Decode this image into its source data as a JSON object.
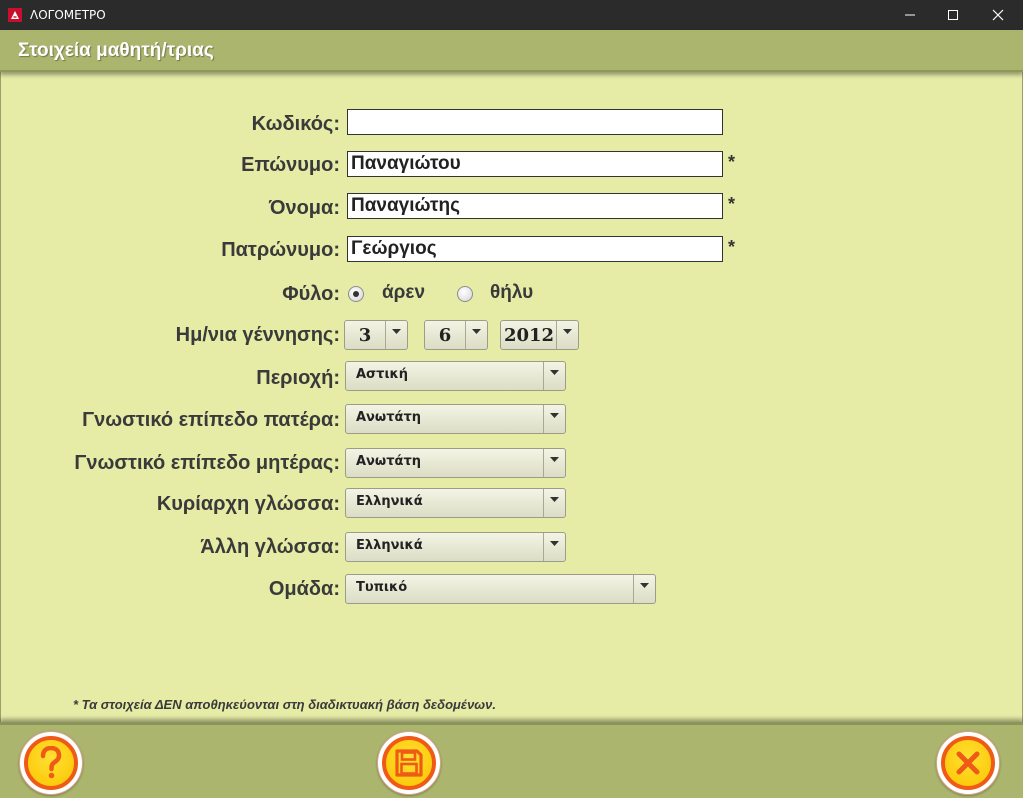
{
  "window": {
    "title": "ΛΟΓΟΜΕΤΡΟ"
  },
  "header": {
    "title": "Στοιχεία μαθητή/τριας"
  },
  "form": {
    "code": {
      "label": "Κωδικός:",
      "value": ""
    },
    "surname": {
      "label": "Επώνυμο:",
      "value": "Παναγιώτου",
      "required_mark": "*"
    },
    "name": {
      "label": "Όνομα:",
      "value": "Παναγιώτης",
      "required_mark": "*"
    },
    "father_name": {
      "label": "Πατρώνυμο:",
      "value": "Γεώργιος",
      "required_mark": "*"
    },
    "gender": {
      "label": "Φύλο:",
      "options": [
        {
          "label": "άρεν",
          "selected": true
        },
        {
          "label": "θήλυ",
          "selected": false
        }
      ]
    },
    "birth_date": {
      "label": "Ημ/νια γέννησης:",
      "day": "3",
      "month": "6",
      "year": "2012"
    },
    "area": {
      "label": "Περιοχή:",
      "value": "Αστική"
    },
    "father_education": {
      "label": "Γνωστικό επίπεδο πατέρα:",
      "value": "Ανωτάτη"
    },
    "mother_education": {
      "label": "Γνωστικό επίπεδο μητέρας:",
      "value": "Ανωτάτη"
    },
    "main_language": {
      "label": "Κυρίαρχη γλώσσα:",
      "value": "Ελληνικά"
    },
    "other_language": {
      "label": "Άλλη γλώσσα:",
      "value": "Ελληνικά"
    },
    "group": {
      "label": "Ομάδα:",
      "value": "Τυπικό"
    }
  },
  "footnote": "* Τα στοιχεία ΔΕΝ αποθηκεύονται στη διαδικτυακή βάση δεδομένων.",
  "footer": {
    "help_icon": "question-icon",
    "save_icon": "floppy-disk-icon",
    "close_icon": "close-icon"
  },
  "colors": {
    "background": "#e6eba6",
    "band": "#abb56d",
    "button_fill": "#fbc400",
    "button_ring": "#ef5a16"
  }
}
